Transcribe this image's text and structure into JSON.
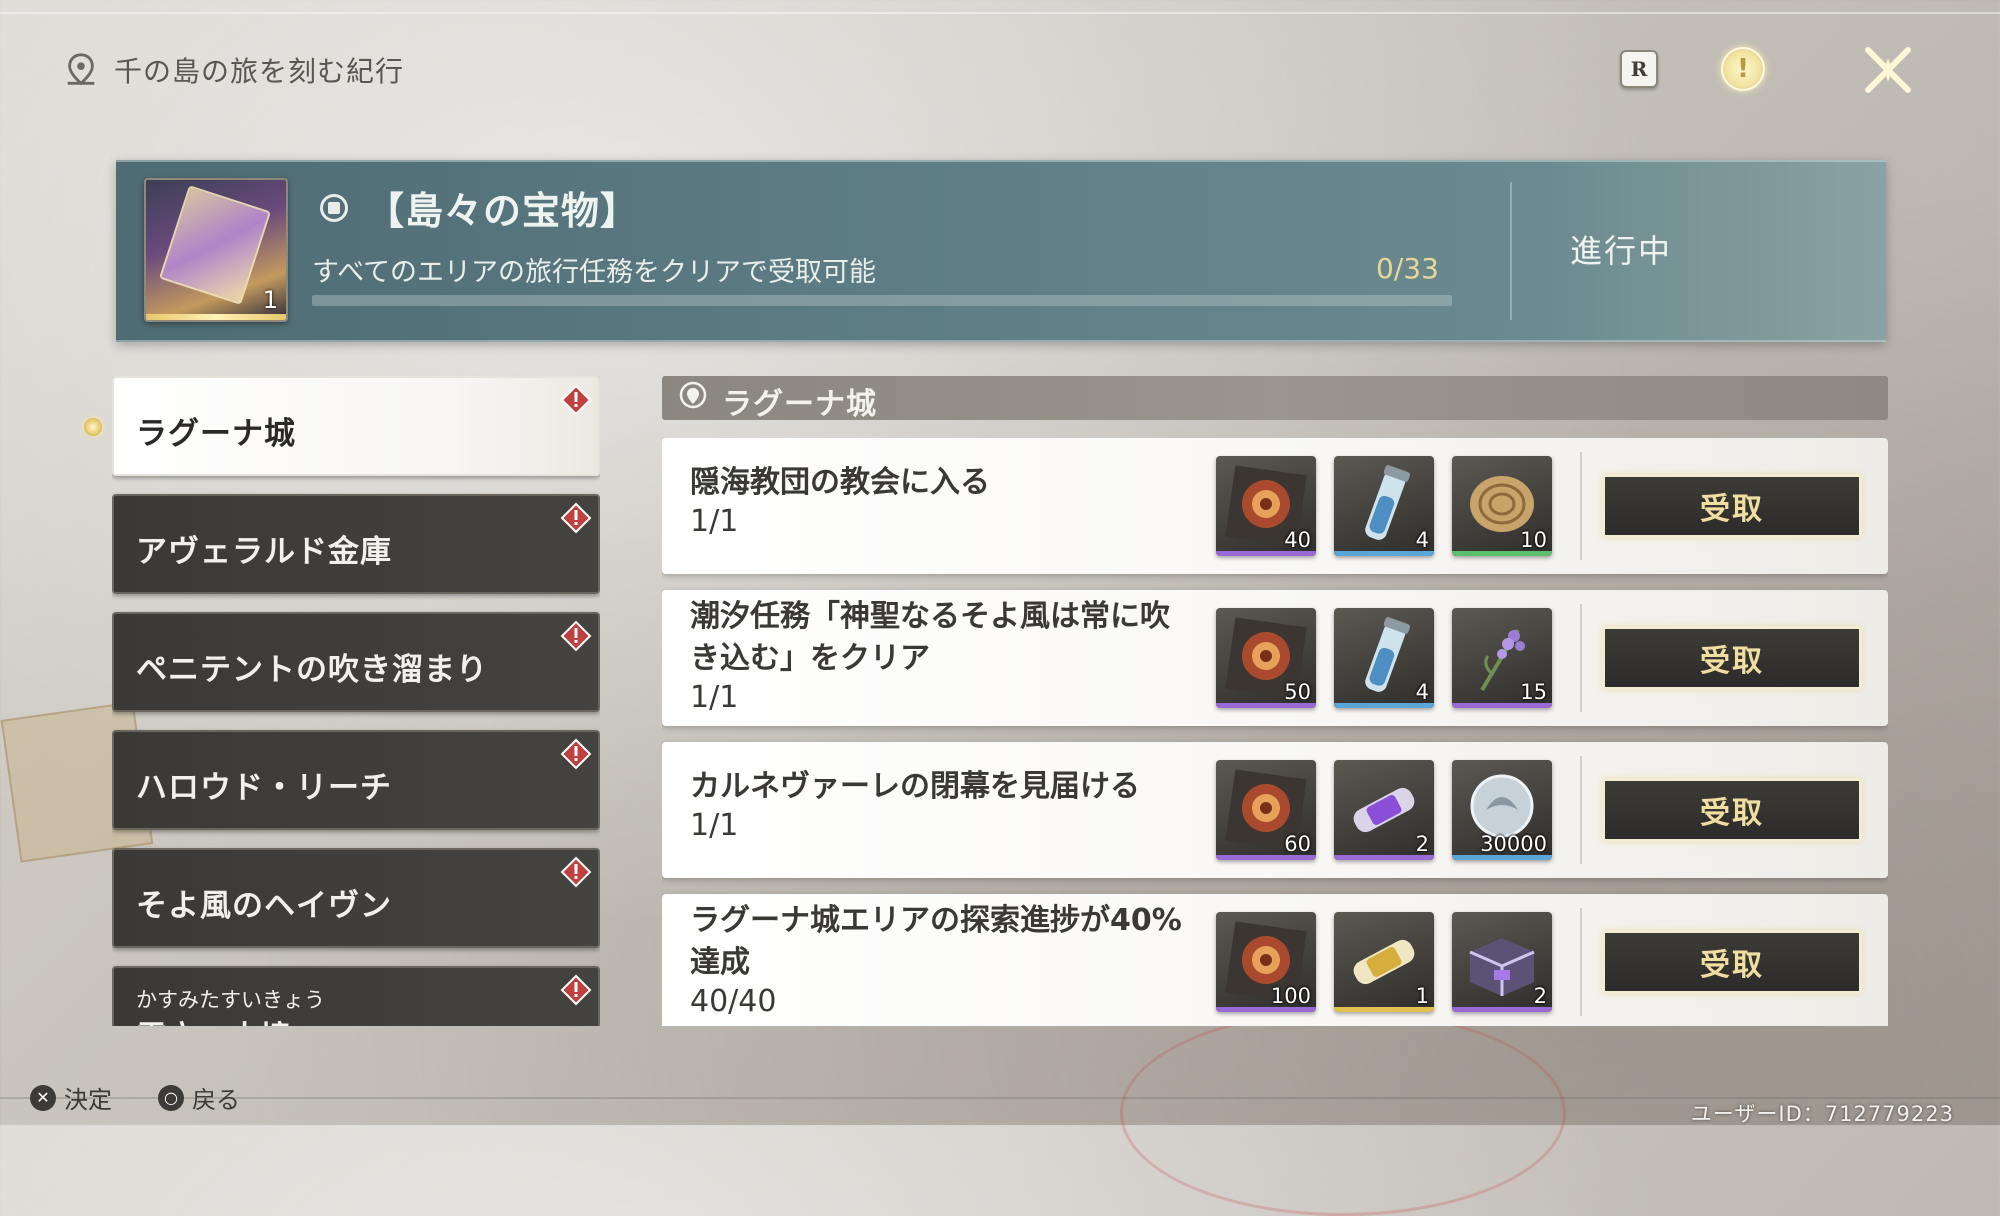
{
  "header": {
    "title": "千の島の旅を刻む紀行",
    "r_button_label": "R",
    "alert_label": "!"
  },
  "banner": {
    "item_qty": "1",
    "title": "【島々の宝物】",
    "description": "すべてのエリアの旅行任務をクリアで受取可能",
    "progress": "0/33",
    "progress_fraction": 0,
    "status": "進行中"
  },
  "areas": [
    {
      "label": "ラグーナ城",
      "active": true
    },
    {
      "label": "アヴェラルド金庫"
    },
    {
      "label": "ペニテントの吹き溜まり"
    },
    {
      "label": "ハロウド・リーチ"
    },
    {
      "label": "そよ風のヘイヴン"
    },
    {
      "furigana": "かすみたすいきょう",
      "label": "霞立つ水境"
    }
  ],
  "section": {
    "title": "ラグーナ城"
  },
  "tasks": [
    {
      "name_lines": [
        "隠海教団の教会に入る"
      ],
      "progress": "1/1",
      "button": "受取",
      "rewards": [
        {
          "icon": "coin-emblem-icon",
          "count": "40",
          "stripe": "#9a6bd6"
        },
        {
          "icon": "vial-icon",
          "count": "4",
          "stripe": "#5aa6d8"
        },
        {
          "icon": "shell-fossil-icon",
          "count": "10",
          "stripe": "#5bbf6c"
        }
      ]
    },
    {
      "name_lines": [
        "潮汐任務「神聖なるそよ風は常に吹",
        "き込む」をクリア"
      ],
      "progress": "1/1",
      "button": "受取",
      "rewards": [
        {
          "icon": "coin-emblem-icon",
          "count": "50",
          "stripe": "#9a6bd6"
        },
        {
          "icon": "vial-icon",
          "count": "4",
          "stripe": "#5aa6d8"
        },
        {
          "icon": "lavender-flower-icon",
          "count": "15",
          "stripe": "#9a6bd6"
        }
      ]
    },
    {
      "name_lines": [
        "カルネヴァーレの閉幕を見届ける"
      ],
      "progress": "1/1",
      "button": "受取",
      "rewards": [
        {
          "icon": "coin-emblem-icon",
          "count": "60",
          "stripe": "#9a6bd6"
        },
        {
          "icon": "purple-capsule-icon",
          "count": "2",
          "stripe": "#9a6bd6"
        },
        {
          "icon": "silver-coin-icon",
          "count": "30000",
          "stripe": "#5aa6d8"
        }
      ]
    },
    {
      "name_lines": [
        "ラグーナ城エリアの探索進捗が40%",
        "達成"
      ],
      "progress": "40/40",
      "button": "受取",
      "rewards": [
        {
          "icon": "coin-emblem-icon",
          "count": "100",
          "stripe": "#9a6bd6"
        },
        {
          "icon": "gold-capsule-icon",
          "count": "1",
          "stripe": "#e2c04f"
        },
        {
          "icon": "purple-chest-icon",
          "count": "2",
          "stripe": "#9a6bd6"
        }
      ]
    }
  ],
  "footer": {
    "confirm_glyph": "✕",
    "confirm_label": "決定",
    "back_glyph": "○",
    "back_label": "戻る",
    "user_id": "ユーザーID：712779223"
  }
}
